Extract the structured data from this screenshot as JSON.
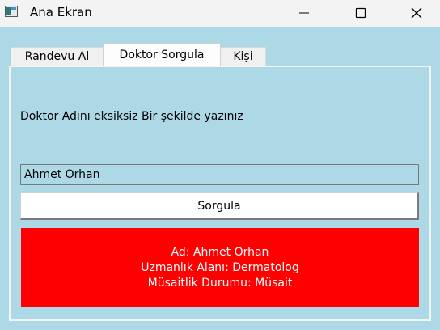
{
  "window": {
    "title": "Ana Ekran",
    "background": "#add8e6",
    "icons": {
      "app": "app-window-icon",
      "minimize": "minimize-icon",
      "maximize": "maximize-icon",
      "close": "close-icon"
    }
  },
  "tabs": [
    {
      "label": "Randevu Al",
      "selected": false
    },
    {
      "label": "Doktor Sorgula",
      "selected": true
    },
    {
      "label": "Kişi",
      "selected": false
    }
  ],
  "doctor_query": {
    "instruction": "Doktor Adını eksiksiz Bir şekilde yazınız",
    "input_value": "Ahmet Orhan",
    "button_label": "Sorgula",
    "result_background": "#ff0000",
    "result_lines": [
      "Ad: Ahmet Orhan",
      "Uzmanlık Alanı: Dermatolog",
      "Müsaitlik Durumu: Müsait"
    ]
  }
}
